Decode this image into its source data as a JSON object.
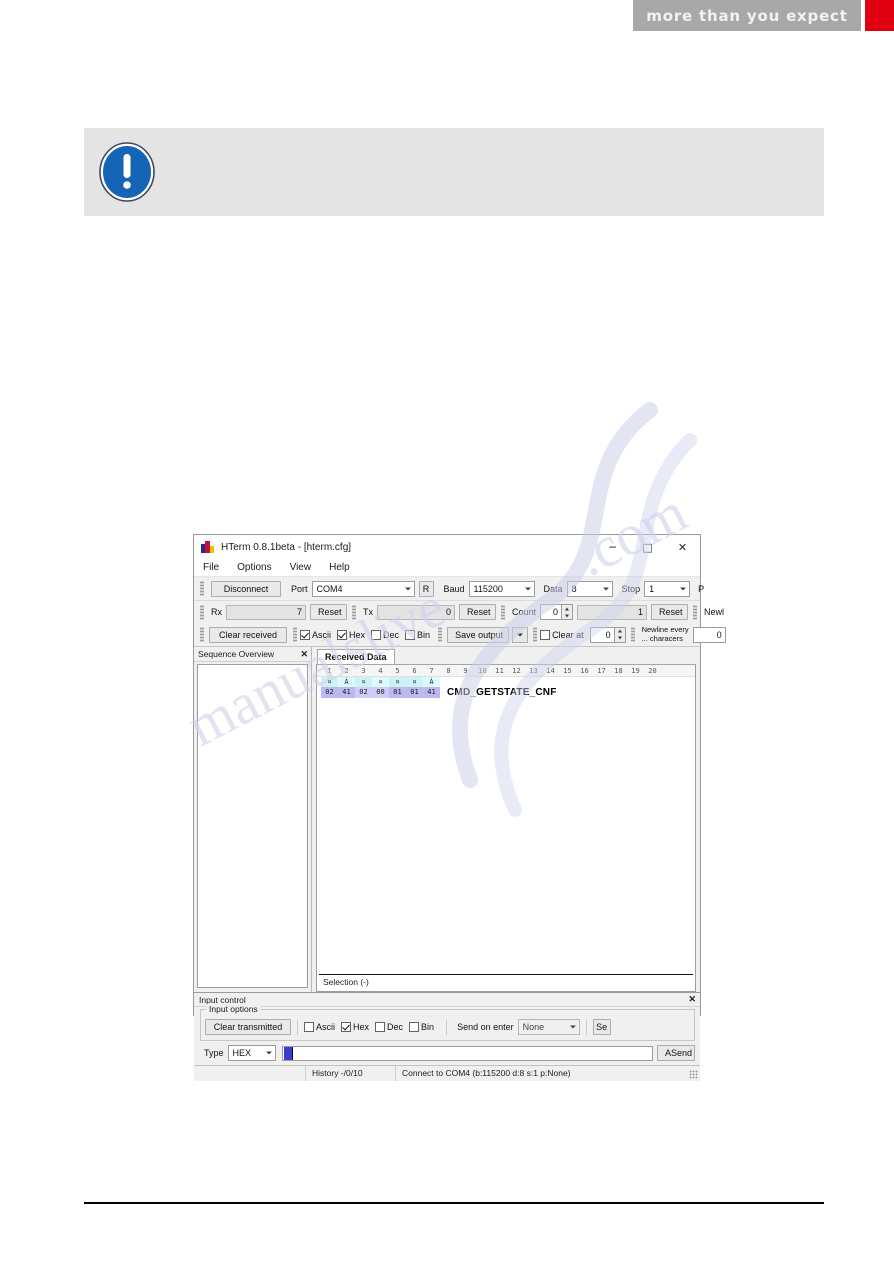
{
  "banner": {
    "tagline": "more than you expect",
    "grey_color": "#a8a8a8",
    "accent_color": "#e1000f"
  },
  "note": {
    "icon": "info-exclamation-icon",
    "text": ""
  },
  "watermark": {
    "line1": "manualslive",
    "line2": ".com"
  },
  "hterm": {
    "titlebar": {
      "title": "HTerm 0.8.1beta - [hterm.cfg]",
      "minimize": "─",
      "maximize": "□",
      "close": "✕"
    },
    "menu": [
      "File",
      "Options",
      "View",
      "Help"
    ],
    "toolbar_row1": {
      "disconnect_label": "Disconnect",
      "port_label": "Port",
      "port_value": "COM4",
      "refresh_label": "R",
      "baud_label": "Baud",
      "baud_value": "115200",
      "data_label": "Data",
      "data_value": "8",
      "stop_label": "Stop",
      "stop_value": "1",
      "parity_label": "P"
    },
    "toolbar_row2": {
      "rx_label": "Rx",
      "rx_value": "7",
      "rx_reset": "Reset",
      "tx_label": "Tx",
      "tx_value": "0",
      "tx_reset": "Reset",
      "count_label": "Count",
      "count_value": "0",
      "count_total": "1",
      "count_reset": "Reset",
      "newline_label": "Newl"
    },
    "toolbar_row3": {
      "clear_received": "Clear received",
      "ascii_label": "Ascii",
      "ascii_checked": true,
      "hex_label": "Hex",
      "hex_checked": true,
      "dec_label": "Dec",
      "dec_checked": false,
      "bin_label": "Bin",
      "bin_checked": false,
      "save_output": "Save output",
      "clear_at_label": "Clear at",
      "clear_at_checked": false,
      "clear_at_value": "0",
      "newline_every_line1": "Newline every",
      "newline_every_line2": "... characers",
      "newline_every_value": "0"
    },
    "sequence_panel": {
      "title": "Sequence Overview",
      "close": "✕"
    },
    "received_tab": "Received Data",
    "ruler": [
      "1",
      "2",
      "3",
      "4",
      "5",
      "6",
      "7",
      "8",
      "9",
      "10",
      "11",
      "12",
      "13",
      "14",
      "15",
      "16",
      "17",
      "18",
      "19",
      "20"
    ],
    "received_data": {
      "ascii": [
        "¤",
        "Á",
        "¤",
        "¤",
        "¤",
        "¤",
        "Á"
      ],
      "hex": [
        "02",
        "41",
        "02",
        "00",
        "01",
        "01",
        "41"
      ],
      "annotation": "CMD_GETSTATE_CNF"
    },
    "selection_label": "Selection (-)",
    "input_control": {
      "title": "Input control",
      "close": "✕",
      "options_title": "Input options",
      "clear_transmitted": "Clear transmitted",
      "ascii_label": "Ascii",
      "ascii_checked": false,
      "hex_label": "Hex",
      "hex_checked": true,
      "dec_label": "Dec",
      "dec_checked": false,
      "bin_label": "Bin",
      "bin_checked": false,
      "send_on_enter_label": "Send on enter",
      "send_on_enter_value": "None",
      "send_button_partial": "Se",
      "type_label": "Type",
      "type_value": "HEX",
      "send_input_value": "",
      "asend_label": "ASend"
    },
    "statusbar": {
      "history": "History -/0/10",
      "connection": "Connect to COM4 (b:115200 d:8 s:1 p:None)"
    }
  }
}
